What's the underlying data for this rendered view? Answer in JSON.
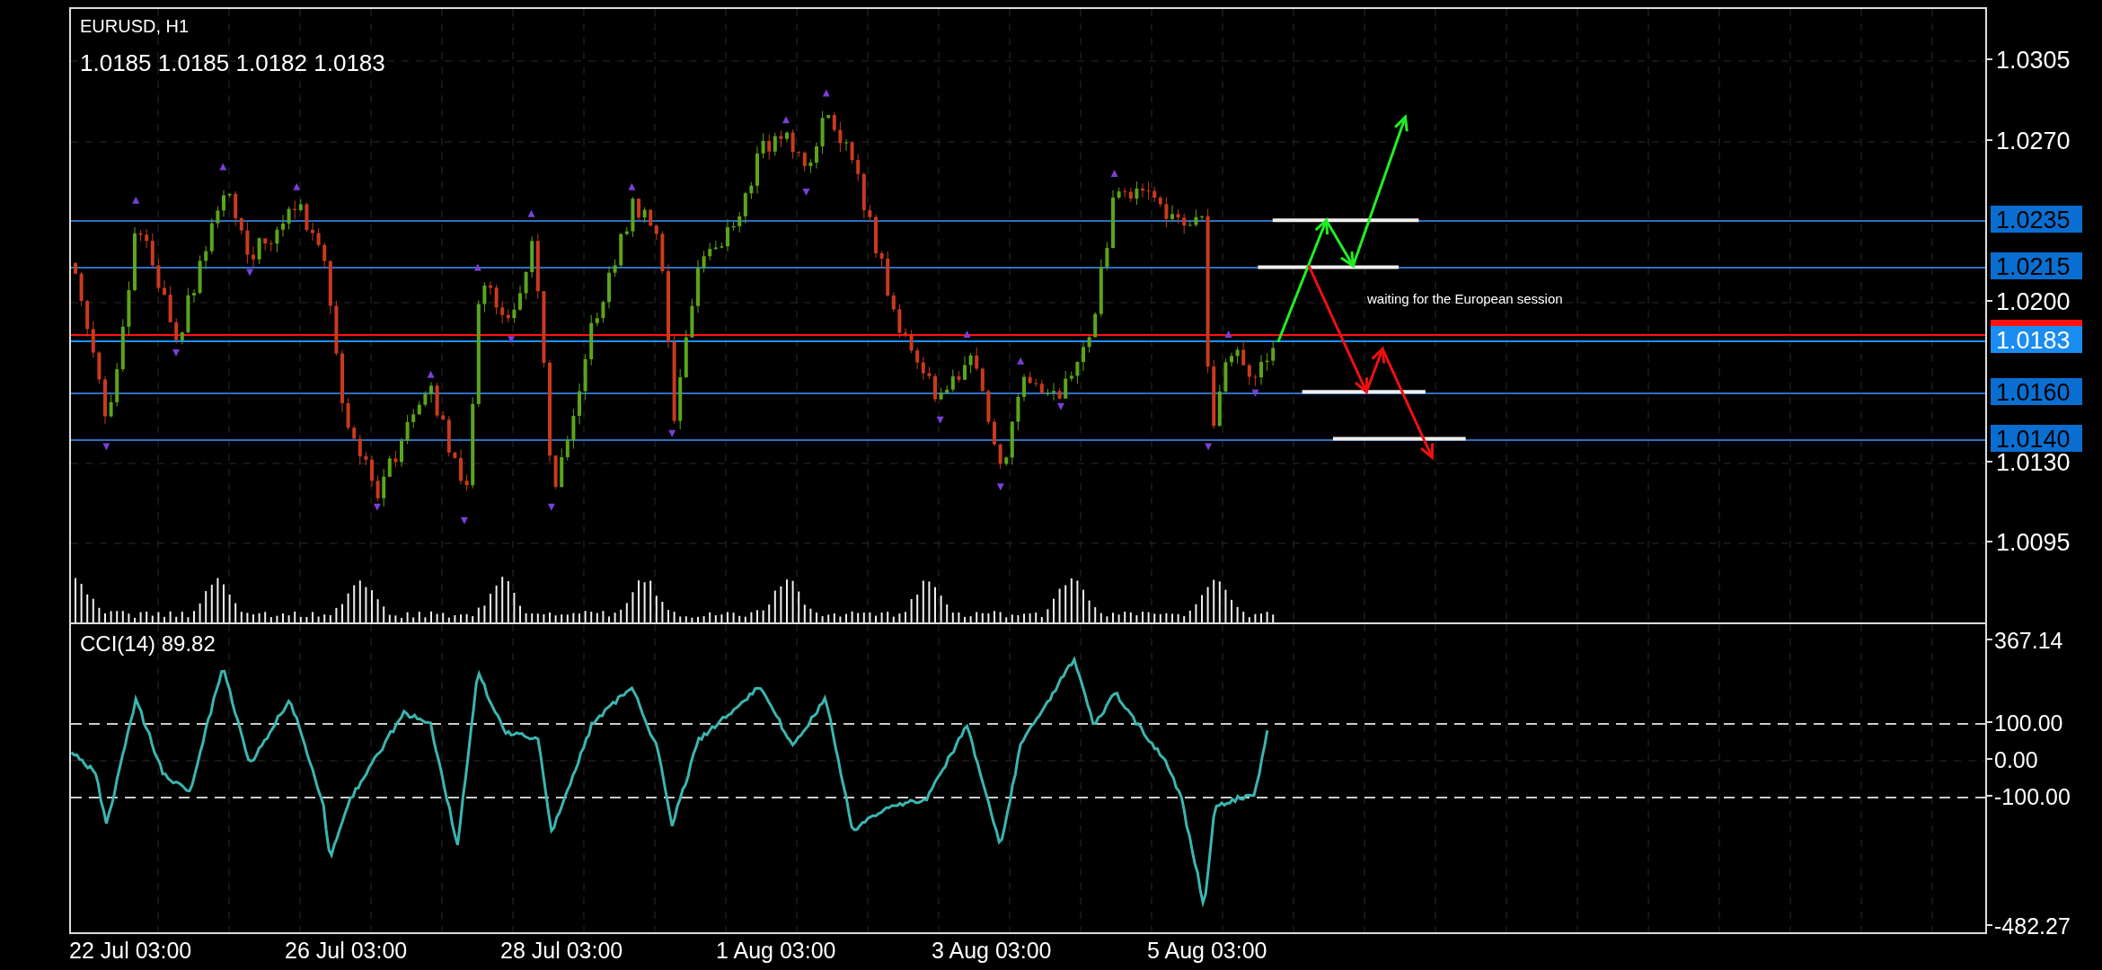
{
  "main_pane": {
    "symbol": "EURUSD, H1",
    "quote": "1.0185 1.0185 1.0182 1.0183",
    "note": "waiting for the European session",
    "price_ticks": [
      "1.0305",
      "1.0270",
      "1.0200",
      "1.0130",
      "1.0095"
    ],
    "levels": [
      {
        "kind": "ask"
      },
      {
        "kind": "level",
        "label": "1.0235"
      },
      {
        "kind": "level",
        "label": "1.0215"
      },
      {
        "kind": "current",
        "label": "1.0183"
      },
      {
        "kind": "level",
        "label": "1.0160"
      },
      {
        "kind": "level",
        "label": "1.0140"
      }
    ]
  },
  "cci_pane": {
    "title": "CCI(14) 89.82",
    "ticks": [
      "367.14",
      "100.00",
      "0.00",
      "-100.00",
      "-482.27"
    ]
  },
  "time_axis": [
    "22 Jul 03:00",
    "26 Jul 03:00",
    "28 Jul 03:00",
    "1 Aug 03:00",
    "3 Aug 03:00",
    "5 Aug 03:00"
  ]
}
